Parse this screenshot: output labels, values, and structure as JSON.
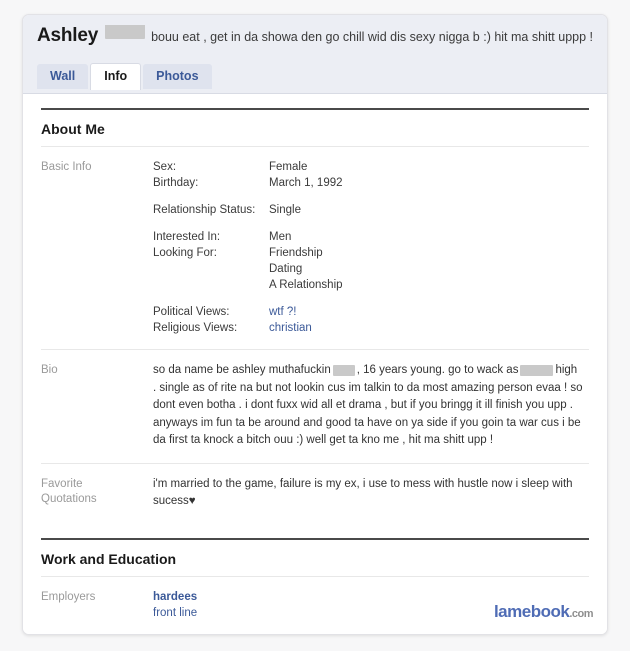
{
  "header": {
    "profile_name": "Ashley",
    "name_redacted": true,
    "status_text": "bouu eat , get in da showa den go chill wid dis sexy nigga b :) hit ma shitt uppp !",
    "tabs": [
      {
        "label": "Wall",
        "active": false
      },
      {
        "label": "Info",
        "active": true
      },
      {
        "label": "Photos",
        "active": false
      }
    ]
  },
  "sections": {
    "about_me": {
      "title": "About Me",
      "basic_info": {
        "label": "Basic Info",
        "fields": [
          {
            "key": "Sex:",
            "value": "Female"
          },
          {
            "key": "Birthday:",
            "value": "March 1, 1992"
          },
          {
            "key": "Relationship Status:",
            "value": "Single"
          },
          {
            "key": "Interested In:",
            "value": "Men"
          },
          {
            "key": "Looking For:",
            "value": "Friendship"
          },
          {
            "key": "",
            "value": "Dating"
          },
          {
            "key": "",
            "value": "A Relationship"
          },
          {
            "key": "Political Views:",
            "value": "wtf ?!",
            "is_link": true
          },
          {
            "key": "Religious Views:",
            "value": "christian",
            "is_link": true
          }
        ],
        "sex_key": "Sex:",
        "sex_value": "Female",
        "birthday_key": "Birthday:",
        "birthday_value": "March 1, 1992",
        "relationship_key": "Relationship Status:",
        "relationship_value": "Single",
        "interested_key": "Interested In:",
        "interested_value": "Men",
        "looking_key": "Looking For:",
        "looking_value_1": "Friendship",
        "looking_value_2": "Dating",
        "looking_value_3": "A Relationship",
        "political_key": "Political Views:",
        "political_value": "wtf ?!",
        "religious_key": "Religious Views:",
        "religious_value": "christian"
      },
      "bio": {
        "label": "Bio",
        "part1": "so da name be ashley muthafuckin",
        "part2": ", 16 years young. go to wack as",
        "part3": "high . single as of rite na but not lookin cus im talkin to da most amazing person evaa ! so dont even botha . i dont fuxx wid all et drama , but if you bringg it ill finish you upp . anyways im fun ta be around and good ta have on ya side if you goin ta war cus i be da first ta knock a bitch ouu :) well get ta kno me , hit ma shitt upp !"
      },
      "favorite_quotations": {
        "label_line1": "Favorite",
        "label_line2": "Quotations",
        "text": "i'm married to the game, failure is my ex, i use to mess with hustle now i sleep with sucess",
        "heart": "♥"
      }
    },
    "work_and_education": {
      "title": "Work and Education",
      "employers": {
        "label": "Employers",
        "primary": "hardees",
        "secondary": "front line"
      }
    }
  },
  "watermark": {
    "main": "lamebook",
    "tld": ".com"
  },
  "colors": {
    "facebook_blue": "#3b5998",
    "header_bg": "#eceef4",
    "tab_bg": "#dfe3ee",
    "label_gray": "#9a9a9a",
    "redaction": "#c9c9c9",
    "watermark_blue": "#4f6cb5"
  }
}
